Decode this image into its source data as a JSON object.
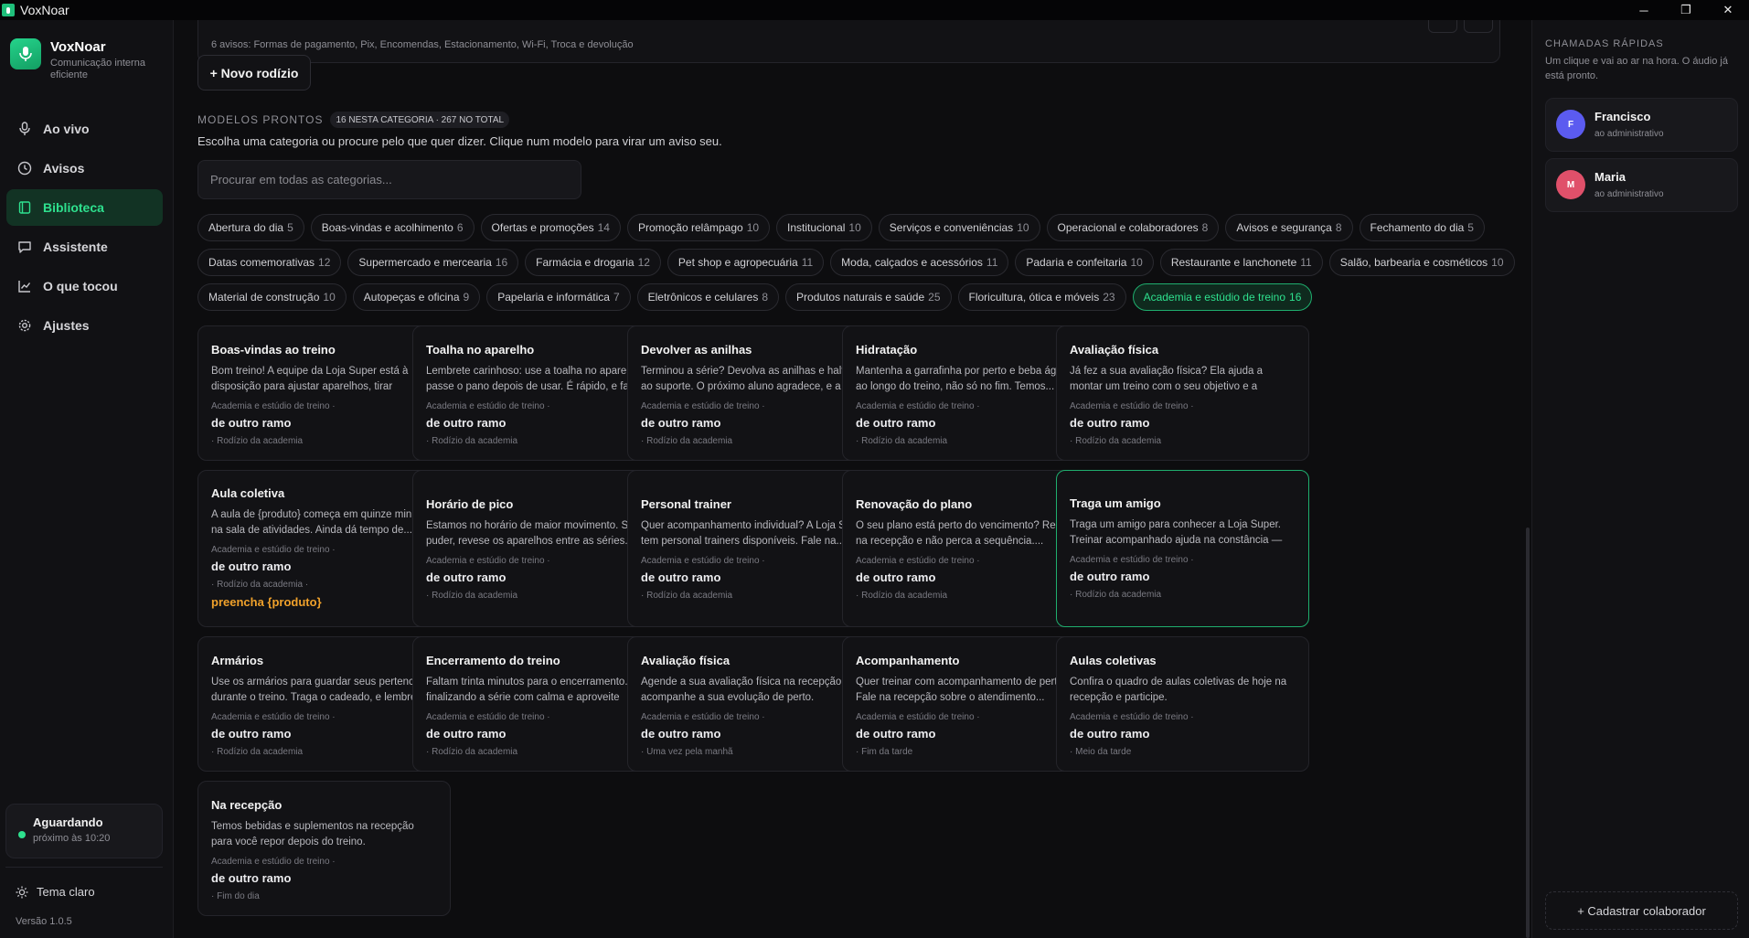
{
  "window": {
    "title": "VoxNoar",
    "controls": {
      "minimize": "─",
      "restore": "❐",
      "close": "✕"
    }
  },
  "brand": {
    "name": "VoxNoar",
    "tagline": "Comunicação interna eficiente",
    "accent": "#2ee08e"
  },
  "nav": [
    {
      "label": "Ao vivo",
      "icon": "microphone-icon"
    },
    {
      "label": "Avisos",
      "icon": "clock-icon"
    },
    {
      "label": "Biblioteca",
      "icon": "book-icon"
    },
    {
      "label": "Assistente",
      "icon": "chat-icon"
    },
    {
      "label": "O que tocou",
      "icon": "chart-line-icon"
    },
    {
      "label": "Ajustes",
      "icon": "gear-icon"
    }
  ],
  "status": {
    "title": "Aguardando",
    "next": "próximo às 10:20"
  },
  "theme": {
    "label": "Tema claro"
  },
  "version": "Versão 1.0.5",
  "top_card": {
    "summary": "6 avisos: Formas de pagamento, Pix, Encomendas, Estacionamento, Wi-Fi, Troca e devolução"
  },
  "new_rotation_label": "+ Novo rodízio",
  "models": {
    "title": "MODELOS PRONTOS",
    "badge": "16 NESTA CATEGORIA · 267 NO TOTAL",
    "description": "Escolha uma categoria ou procure pelo que quer dizer. Clique num modelo para virar um aviso seu.",
    "search_placeholder": "Procurar em todas as categorias..."
  },
  "categories": [
    [
      {
        "name": "Abertura do dia",
        "count": "5"
      },
      {
        "name": "Boas-vindas e acolhimento",
        "count": "6"
      },
      {
        "name": "Ofertas e promoções",
        "count": "14"
      },
      {
        "name": "Promoção relâmpago",
        "count": "10"
      },
      {
        "name": "Institucional",
        "count": "10"
      },
      {
        "name": "Serviços e conveniências",
        "count": "10"
      },
      {
        "name": "Operacional e colaboradores",
        "count": "8"
      },
      {
        "name": "Avisos e segurança",
        "count": "8"
      },
      {
        "name": "Fechamento do dia",
        "count": "5"
      }
    ],
    [
      {
        "name": "Datas comemorativas",
        "count": "12"
      },
      {
        "name": "Supermercado e mercearia",
        "count": "16"
      },
      {
        "name": "Farmácia e drogaria",
        "count": "12"
      },
      {
        "name": "Pet shop e agropecuária",
        "count": "11"
      },
      {
        "name": "Moda, calçados e acessórios",
        "count": "11"
      },
      {
        "name": "Padaria e confeitaria",
        "count": "10"
      },
      {
        "name": "Restaurante e lanchonete",
        "count": "11"
      },
      {
        "name": "Salão, barbearia e cosméticos",
        "count": "10"
      }
    ],
    [
      {
        "name": "Material de construção",
        "count": "10"
      },
      {
        "name": "Autopeças e oficina",
        "count": "9"
      },
      {
        "name": "Papelaria e informática",
        "count": "7"
      },
      {
        "name": "Eletrônicos e celulares",
        "count": "8"
      },
      {
        "name": "Produtos naturais e saúde",
        "count": "25"
      },
      {
        "name": "Floricultura, ótica e móveis",
        "count": "23"
      },
      {
        "name": "Academia e estúdio de treino",
        "count": "16",
        "active": true
      }
    ]
  ],
  "cards": [
    {
      "title": "Boas-vindas ao treino",
      "body": "Bom treino! A equipe da Loja Super está à disposição para ajustar aparelhos, tirar dúvidas...",
      "category": "Academia e estúdio de treino ·",
      "branch": "de outro ramo",
      "tag": "· Rodízio da academia"
    },
    {
      "title": "Toalha no aparelho",
      "body": "Lembrete carinhoso: use a toalha no aparelho e passe o pano depois de usar. É rápido, e faz...",
      "category": "Academia e estúdio de treino ·",
      "branch": "de outro ramo",
      "tag": "· Rodízio da academia"
    },
    {
      "title": "Devolver as anilhas",
      "body": "Terminou a série? Devolva as anilhas e halteres ao suporte. O próximo aluno agradece, e a sala...",
      "category": "Academia e estúdio de treino ·",
      "branch": "de outro ramo",
      "tag": "· Rodízio da academia"
    },
    {
      "title": "Hidratação",
      "body": "Mantenha a garrafinha por perto e beba água ao longo do treino, não só no fim. Temos...",
      "category": "Academia e estúdio de treino ·",
      "branch": "de outro ramo",
      "tag": "· Rodízio da academia"
    },
    {
      "title": "Avaliação física",
      "body": "Já fez a sua avaliação física? Ela ajuda a montar um treino com o seu objetivo e a acompanhar ...",
      "category": "Academia e estúdio de treino ·",
      "branch": "de outro ramo",
      "tag": "· Rodízio da academia"
    },
    {
      "title": "Aula coletiva",
      "body": "A aula de {produto} começa em quinze minutos na sala de atividades. Ainda dá tempo de...",
      "category": "Academia e estúdio de treino ·",
      "branch": "de outro ramo",
      "tag": "· Rodízio da academia ·",
      "warning": "preencha {produto}"
    },
    {
      "title": "Horário de pico",
      "body": "Estamos no horário de maior movimento. Se puder, revese os aparelhos entre as séries. Tod...",
      "category": "Academia e estúdio de treino ·",
      "branch": "de outro ramo",
      "tag": "· Rodízio da academia"
    },
    {
      "title": "Personal trainer",
      "body": "Quer acompanhamento individual? A Loja Super tem personal trainers disponíveis. Fale na...",
      "category": "Academia e estúdio de treino ·",
      "branch": "de outro ramo",
      "tag": "· Rodízio da academia"
    },
    {
      "title": "Renovação do plano",
      "body": "O seu plano está perto do vencimento? Renove na recepção e não perca a sequência....",
      "category": "Academia e estúdio de treino ·",
      "branch": "de outro ramo",
      "tag": "· Rodízio da academia"
    },
    {
      "title": "Traga um amigo",
      "body": "Traga um amigo para conhecer a Loja Super. Treinar acompanhado ajuda na constância — e...",
      "category": "Academia e estúdio de treino ·",
      "branch": "de outro ramo",
      "tag": "· Rodízio da academia",
      "selected": true
    },
    {
      "title": "Armários",
      "body": "Use os armários para guardar seus pertences durante o treino. Traga o cadeado, e lembre de...",
      "category": "Academia e estúdio de treino ·",
      "branch": "de outro ramo",
      "tag": "· Rodízio da academia"
    },
    {
      "title": "Encerramento do treino",
      "body": "Faltam trinta minutos para o encerramento. Vá finalizando a série com calma e aproveite para...",
      "category": "Academia e estúdio de treino ·",
      "branch": "de outro ramo",
      "tag": "· Rodízio da academia"
    },
    {
      "title": "Avaliação física",
      "body": "Agende a sua avaliação física na recepção e acompanhe a sua evolução de perto.",
      "category": "Academia e estúdio de treino ·",
      "branch": "de outro ramo",
      "tag": "· Uma vez pela manhã"
    },
    {
      "title": "Acompanhamento",
      "body": "Quer treinar com acompanhamento de perto? Fale na recepção sobre o atendimento...",
      "category": "Academia e estúdio de treino ·",
      "branch": "de outro ramo",
      "tag": "· Fim da tarde"
    },
    {
      "title": "Aulas coletivas",
      "body": "Confira o quadro de aulas coletivas de hoje na recepção e participe.",
      "category": "Academia e estúdio de treino ·",
      "branch": "de outro ramo",
      "tag": "· Meio da tarde"
    },
    {
      "title": "Na recepção",
      "body": "Temos bebidas e suplementos na recepção para você repor depois do treino.",
      "category": "Academia e estúdio de treino ·",
      "branch": "de outro ramo",
      "tag": "· Fim do dia"
    }
  ],
  "quick_calls": {
    "title": "CHAMADAS RÁPIDAS",
    "description": "Um clique e vai ao ar na hora. O áudio já está pronto.",
    "contacts": [
      {
        "initial": "F",
        "name": "Francisco",
        "role": "ao administrativo",
        "color": "#5b5bf0"
      },
      {
        "initial": "M",
        "name": "Maria",
        "role": "ao administrativo",
        "color": "#e0506a"
      }
    ],
    "register_label": "+ Cadastrar colaborador"
  }
}
